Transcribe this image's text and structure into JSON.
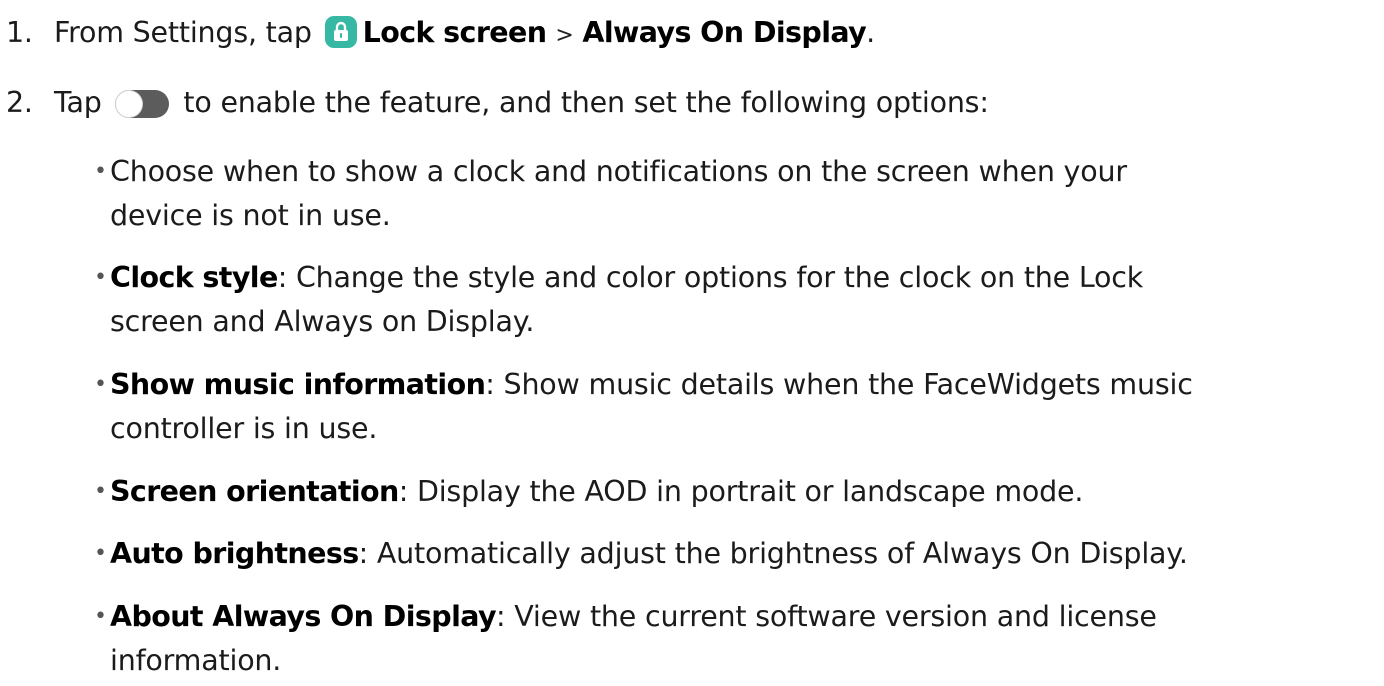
{
  "steps": [
    {
      "number": "1.",
      "prefix": "From Settings, tap",
      "icon": "lock-screen-icon",
      "link1": "Lock screen",
      "separator": ">",
      "link2": "Always On Display",
      "suffix": "."
    },
    {
      "number": "2.",
      "prefix": "Tap",
      "icon": "toggle-switch-icon",
      "rest": "to enable the feature, and then set the following options:"
    }
  ],
  "bullets": [
    {
      "lines": [
        "Choose when to show a clock and notifications on the screen when your",
        "device is not in use."
      ]
    },
    {
      "term": "Clock style",
      "colon": ":",
      "desc_lines": [
        " Change the style and color options for the clock on the Lock",
        "screen and Always on Display."
      ]
    },
    {
      "term": "Show music information",
      "colon": ":",
      "desc_lines": [
        " Show music details when the FaceWidgets music",
        "controller is in use."
      ]
    },
    {
      "term": "Screen orientation",
      "colon": ":",
      "desc_lines": [
        " Display the AOD in portrait or landscape mode."
      ]
    },
    {
      "term": "Auto brightness",
      "colon": ":",
      "desc_lines": [
        " Automatically adjust the brightness of Always On Display."
      ]
    },
    {
      "term": "About Always On Display",
      "colon": ":",
      "desc_lines": [
        " View the current software version and license",
        "information."
      ]
    }
  ],
  "bullet_char": "•",
  "colors": {
    "lock_icon_bg": "#37b8a5",
    "toggle_bg": "#5c5c5c"
  }
}
